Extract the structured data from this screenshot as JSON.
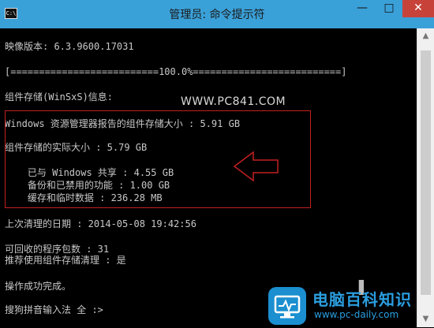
{
  "window": {
    "title": "管理员: 命令提示符",
    "icon_label": "C:\\",
    "controls": {
      "minimize": "—",
      "maximize": "□",
      "close": "✕"
    }
  },
  "console": {
    "lines": [
      "映像版本: 6.3.9600.17031",
      "[==========================100.0%==========================]",
      "组件存储(WinSxS)信息:",
      "Windows 资源管理器报告的组件存储大小 : 5.91 GB",
      "组件存储的实际大小 : 5.79 GB",
      "    已与 Windows 共享 : 4.55 GB",
      "    备份和已禁用的功能 : 1.00 GB",
      "    缓存和临时数据 : 236.28 MB",
      "上次清理的日期 : 2014-05-08 19:42:56",
      "可回收的程序包数 : 31",
      "推荐使用组件存储清理 : 是",
      "操作成功完成。",
      "搜狗拼音输入法 全 :>"
    ]
  },
  "watermark": {
    "url": "WWW.PC841.COM"
  },
  "brand": {
    "name": "电脑百科知识",
    "url": "www.pc-daily.com"
  },
  "colors": {
    "titlebar": "#3aa0d8",
    "console_bg": "#000000",
    "console_text": "#c8c8c8",
    "highlight": "#c32020",
    "brand": "#2b9ee0"
  }
}
